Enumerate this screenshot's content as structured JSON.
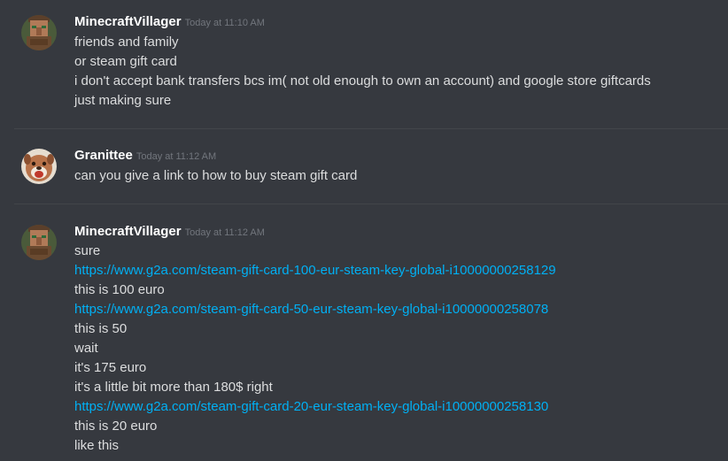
{
  "messages": [
    {
      "author": "MinecraftVillager",
      "avatar_icon": "villager-avatar-icon",
      "timestamp": "Today at 11:10 AM",
      "lines": [
        "friends and family",
        "or steam gift card",
        "i don't accept bank transfers bcs im( not old enough to own an account) and google store giftcards",
        "just making sure"
      ]
    },
    {
      "author": "Granittee",
      "avatar_icon": "dog-avatar-icon",
      "timestamp": "Today at 11:12 AM",
      "lines": [
        "can you give a link to how to buy steam gift card"
      ]
    },
    {
      "author": "MinecraftVillager",
      "avatar_icon": "villager-avatar-icon",
      "timestamp": "Today at 11:12 AM",
      "lines": [
        "sure",
        "https://www.g2a.com/steam-gift-card-100-eur-steam-key-global-i10000000258129",
        "this is 100 euro",
        "https://www.g2a.com/steam-gift-card-50-eur-steam-key-global-i10000000258078",
        "this is 50",
        "wait",
        "it's 175 euro",
        "it's a little bit more than 180$ right",
        "https://www.g2a.com/steam-gift-card-20-eur-steam-key-global-i10000000258130",
        "this is 20 euro",
        "like this"
      ]
    }
  ],
  "colors": {
    "background": "#36393f",
    "username": "#ffffff",
    "timestamp": "#72767d",
    "text": "#dcddde",
    "link": "#00b0f4",
    "divider": "#42454a"
  }
}
